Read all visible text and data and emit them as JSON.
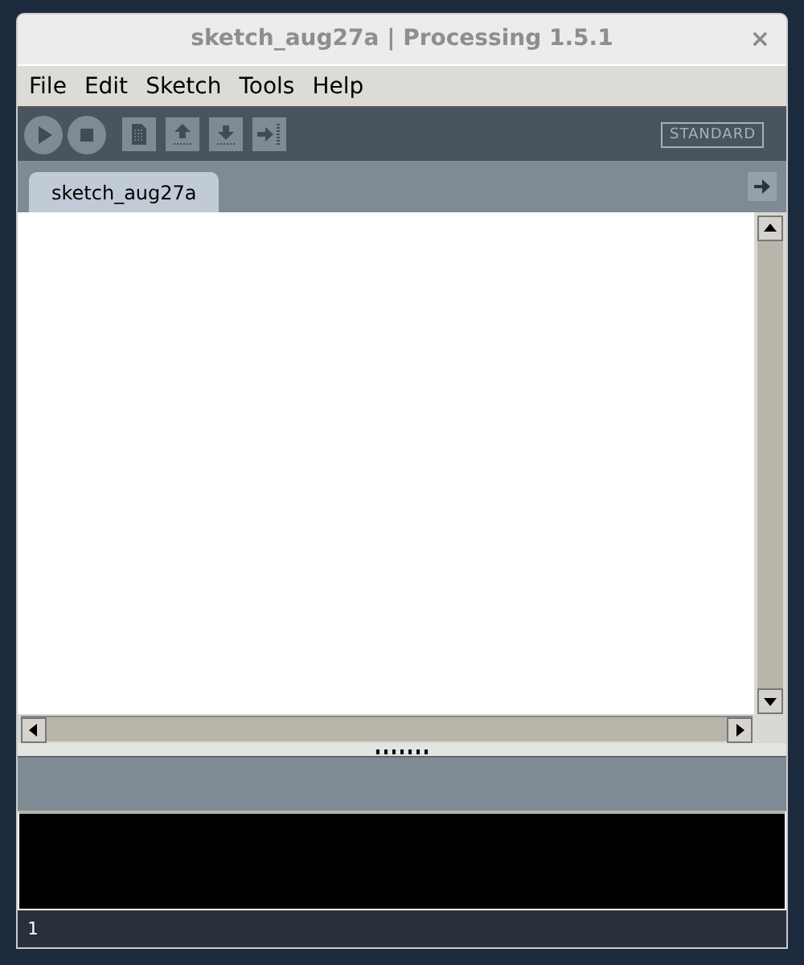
{
  "window": {
    "title": "sketch_aug27a | Processing 1.5.1",
    "close": "×"
  },
  "menu": [
    "File",
    "Edit",
    "Sketch",
    "Tools",
    "Help"
  ],
  "toolbar": {
    "buttons": [
      {
        "kind": "run"
      },
      {
        "kind": "stop"
      },
      {
        "kind": "new"
      },
      {
        "kind": "open"
      },
      {
        "kind": "save"
      },
      {
        "kind": "export"
      }
    ],
    "mode": "STANDARD"
  },
  "tabs": [
    {
      "label": "sketch_aug27a",
      "selected": true
    }
  ],
  "status_bar": {
    "line": "1"
  }
}
